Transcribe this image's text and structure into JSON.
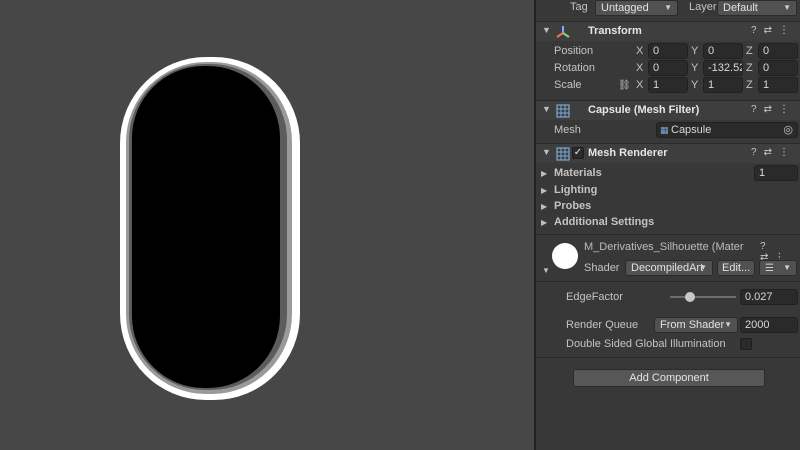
{
  "top": {
    "tag_label": "Tag",
    "tag_value": "Untagged",
    "layer_label": "Layer",
    "layer_value": "Default"
  },
  "transform": {
    "title": "Transform",
    "position_label": "Position",
    "position": {
      "x": "0",
      "y": "0",
      "z": "0"
    },
    "rotation_label": "Rotation",
    "rotation": {
      "x": "0",
      "y": "-132.52",
      "z": "0"
    },
    "scale_label": "Scale",
    "scale": {
      "x": "1",
      "y": "1",
      "z": "1"
    }
  },
  "mesh_filter": {
    "title": "Capsule (Mesh Filter)",
    "mesh_label": "Mesh",
    "mesh_value": "Capsule"
  },
  "mesh_renderer": {
    "title": "Mesh Renderer",
    "enabled": true,
    "sections": [
      "Materials",
      "Lighting",
      "Probes",
      "Additional Settings"
    ],
    "materials_count": "1"
  },
  "material": {
    "name": "M_Derivatives_Silhouette (Mater",
    "shader_label": "Shader",
    "shader_value": "DecompiledArt",
    "edit_label": "Edit...",
    "edge_factor_label": "EdgeFactor",
    "edge_factor_value": "0.027",
    "edge_factor_level": 0.03,
    "render_queue_label": "Render Queue",
    "render_queue_source": "From Shader",
    "render_queue_value": "2000",
    "double_sided_label": "Double Sided Global Illumination",
    "double_sided_checked": false
  },
  "add_component_label": "Add Component",
  "axis": {
    "x": "X",
    "y": "Y",
    "z": "Z"
  },
  "colors": {
    "scene_bg": "#474747",
    "panel_bg": "#383838",
    "capsule": "#000000",
    "rim": "#ffffff"
  }
}
